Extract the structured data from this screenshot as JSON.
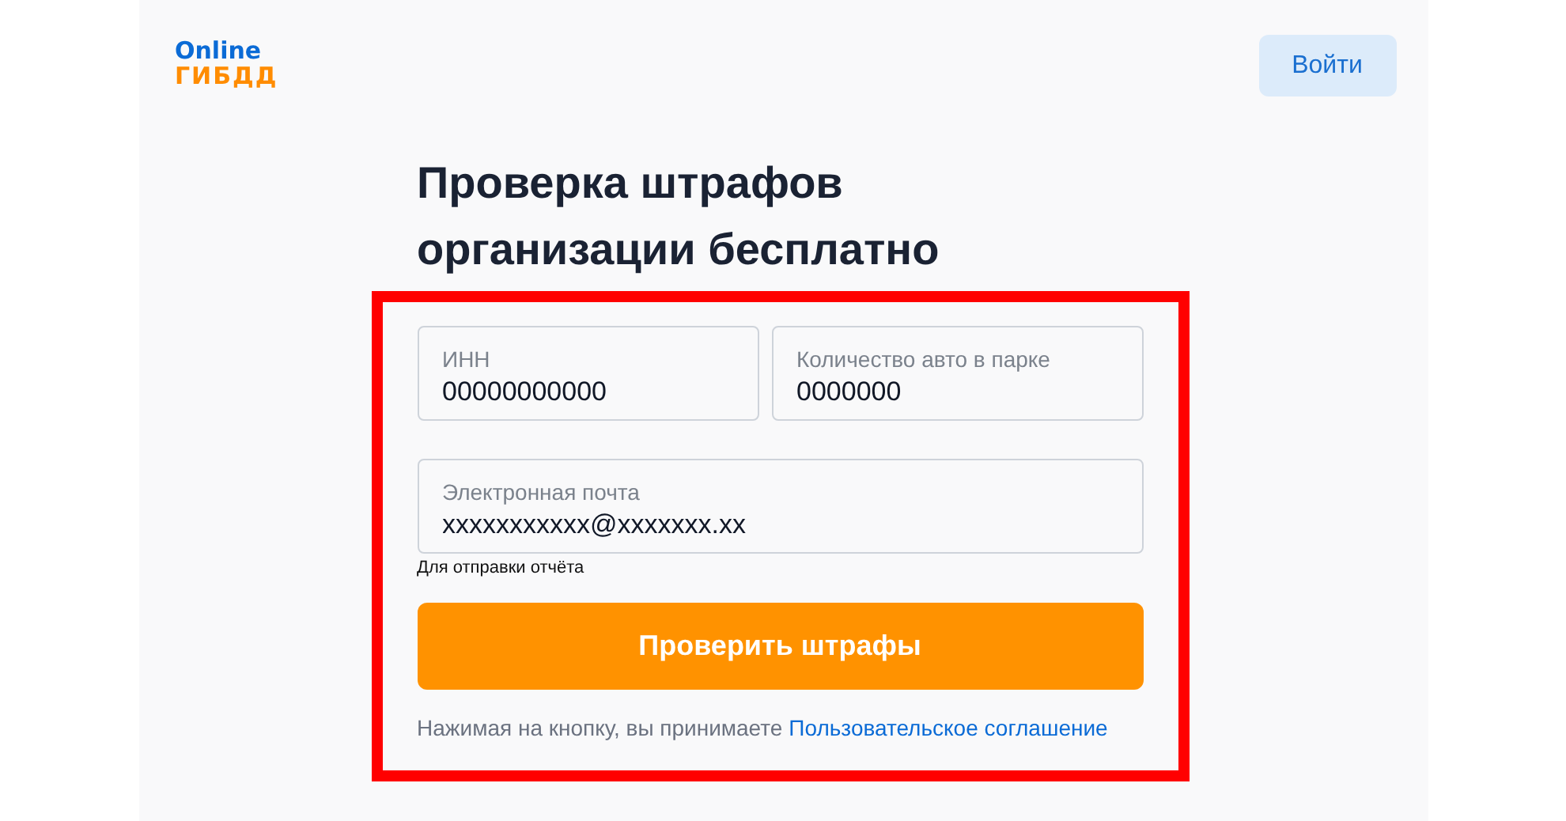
{
  "logo": {
    "line_1": "Online",
    "line_2": "ГИБДД"
  },
  "header": {
    "login_button": "Войти"
  },
  "title": "Проверка штрафов организации бесплатно",
  "form": {
    "fields": [
      {
        "label": "ИНН",
        "value": "00000000000"
      },
      {
        "label": "Количество авто в парке",
        "value": "0000000"
      },
      {
        "label": "Электронная почта",
        "value": "xxxxxxxxxxx@xxxxxxx.xx",
        "hint": "Для отправки отчёта"
      }
    ],
    "submit_button": "Проверить штрафы",
    "agreement_text": "Нажимая на кнопку, вы принимаете",
    "agreement_link": "Пользовательское соглашение"
  }
}
